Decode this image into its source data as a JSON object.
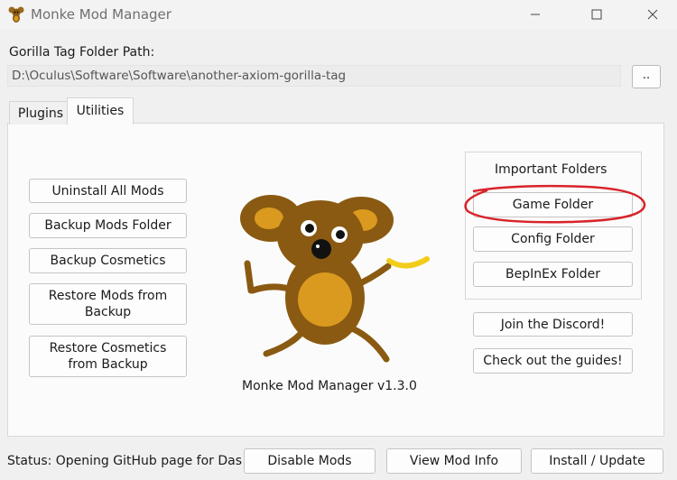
{
  "window": {
    "title": "Monke Mod Manager",
    "icon": "monkey-icon"
  },
  "path": {
    "label": "Gorilla Tag Folder Path:",
    "value": "D:\\Oculus\\Software\\Software\\another-axiom-gorilla-tag",
    "browse_label": ".."
  },
  "tabs": [
    {
      "label": "Plugins",
      "active": false
    },
    {
      "label": "Utilities",
      "active": true
    }
  ],
  "utilities": {
    "left_buttons": [
      {
        "label": "Uninstall All Mods"
      },
      {
        "label": "Backup Mods Folder"
      },
      {
        "label": "Backup Cosmetics"
      },
      {
        "label": "Restore Mods from Backup"
      },
      {
        "label": "Restore Cosmetics from Backup"
      }
    ],
    "important_folders": {
      "title": "Important Folders",
      "buttons": [
        {
          "label": "Game Folder"
        },
        {
          "label": "Config Folder"
        },
        {
          "label": "BepInEx Folder"
        }
      ]
    },
    "discord_label": "Join the Discord!",
    "guides_label": "Check out the guides!",
    "version_text": "Monke Mod Manager v1.3.0"
  },
  "footer": {
    "status_text": "Status: Opening GitHub page for Das",
    "disable_label": "Disable Mods",
    "view_info_label": "View Mod Info",
    "install_label": "Install / Update"
  },
  "colors": {
    "annotation_circle": "#d8232a",
    "monkey_brown": "#8a5a12",
    "monkey_tan": "#d99a1f",
    "banana": "#f2cc1a"
  }
}
